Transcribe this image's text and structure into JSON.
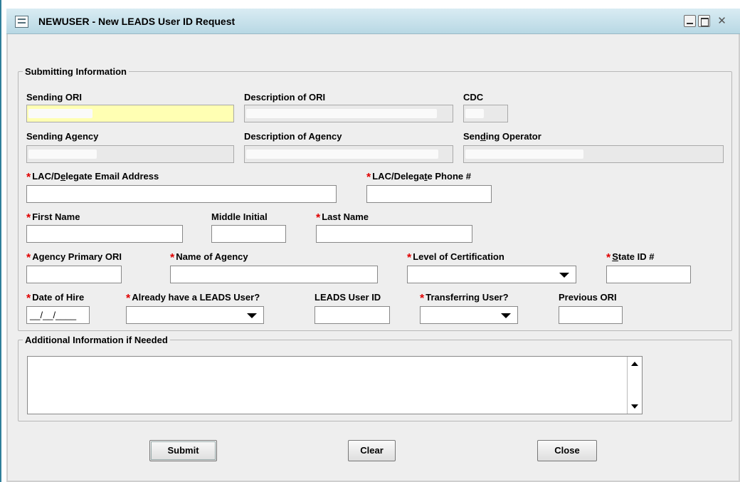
{
  "window": {
    "title": "NEWUSER - New LEADS User ID Request",
    "close_glyph": "✕"
  },
  "submitting": {
    "legend": "Submitting Information",
    "sending_ori_label": "Sending ORI",
    "description_ori_label": "Description of ORI",
    "cdc_label": "CDC",
    "sending_agency_label": "Sending Agency",
    "description_agency_label": "Description of Agency",
    "sending_operator_label": {
      "pre": "Sen",
      "u": "d",
      "post": "ing Operator"
    },
    "lac_email_label": {
      "pre": "LAC/D",
      "u": "e",
      "post": "legate Email Address"
    },
    "lac_phone_label": {
      "pre": "LAC/Delega",
      "u": "t",
      "post": "e Phone #"
    },
    "first_name_label": "First Name",
    "middle_initial_label": "Middle Initial",
    "last_name_label": "Last Name",
    "agency_primary_ori_label": "Agency Primary ORI",
    "name_of_agency_label": "Name of Agency",
    "level_certification_label": "Level of Certification",
    "state_id_label": {
      "pre": "",
      "u": "S",
      "post": "tate ID #"
    },
    "date_of_hire_label": "Date of Hire",
    "date_of_hire_value": "__/__/____",
    "already_leads_user_label": "Already have a LEADS User?",
    "leads_user_id_label": "LEADS User ID",
    "transferring_user_label": "Transferring User?",
    "previous_ori_label": "Previous ORI",
    "required_marker": "*"
  },
  "additional": {
    "legend": "Additional Information if Needed"
  },
  "buttons": {
    "submit": "Submit",
    "clear": "Clear",
    "close": "Close"
  },
  "colors": {
    "title_bar": "#c8e2ec",
    "required": "#e00000",
    "highlight_field": "#ffffb3",
    "readonly_field": "#e9e9e9"
  }
}
